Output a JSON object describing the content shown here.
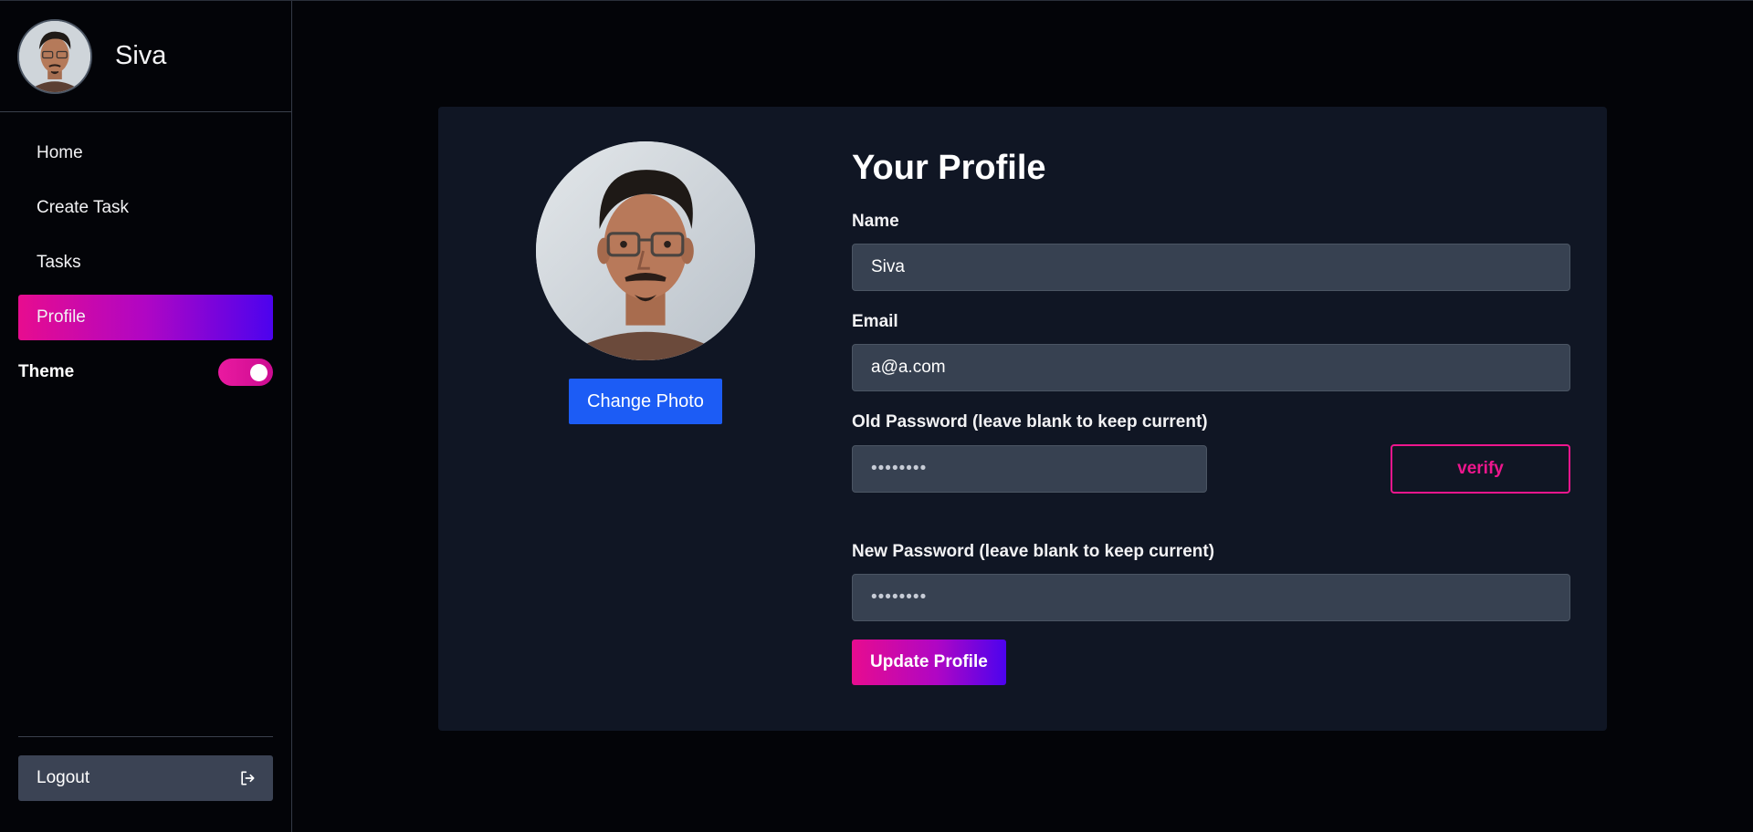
{
  "sidebar": {
    "user_name": "Siva",
    "nav": [
      {
        "label": "Home"
      },
      {
        "label": "Create Task"
      },
      {
        "label": "Tasks"
      },
      {
        "label": "Profile",
        "active": true
      }
    ],
    "theme_label": "Theme",
    "theme_toggle_on": true,
    "logout_label": "Logout",
    "logout_icon": "logout-arrow-icon"
  },
  "profile": {
    "title": "Your Profile",
    "change_photo_label": "Change Photo",
    "name_label": "Name",
    "name_value": "Siva",
    "email_label": "Email",
    "email_value": "a@a.com",
    "old_password_label": "Old Password (leave blank to keep current)",
    "old_password_placeholder": "••••••••",
    "verify_label": "verify",
    "new_password_label": "New Password (leave blank to keep current)",
    "new_password_placeholder": "••••••••",
    "update_label": "Update Profile"
  },
  "colors": {
    "background": "#030408",
    "card": "#101624",
    "input": "#374151",
    "accent_pink": "#e70c8f",
    "accent_violet": "#4c03ee",
    "primary_blue": "#1c5cf5",
    "logout_bg": "#3b4354"
  }
}
